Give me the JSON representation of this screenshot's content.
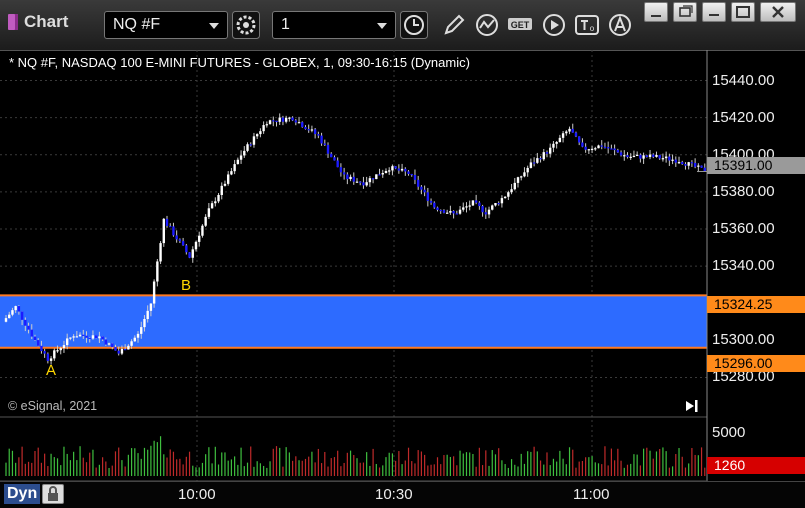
{
  "app": {
    "title": "Chart"
  },
  "toolbar": {
    "symbol": "NQ #F",
    "interval": "1"
  },
  "chart": {
    "symbol_title": "* NQ #F, NASDAQ 100 E-MINI FUTURES - GLOBEX, 1, 09:30-16:15 (Dynamic)",
    "copyright": "© eSignal, 2021",
    "current_price_label": "15391.00",
    "zone_high_label": "15324.25",
    "zone_low_label": "15296.00",
    "volume_label": "1260",
    "bottom_label": "Dyn",
    "marker_a": "A",
    "marker_b": "B",
    "y_ticks": [
      "15440.00",
      "15420.00",
      "15400.00",
      "15380.00",
      "15360.00",
      "15340.00",
      "15320.00",
      "15300.00",
      "15280.00"
    ],
    "volume_ticks": [
      "5000"
    ],
    "x_ticks": [
      "10:00",
      "10:30",
      "11:00"
    ]
  },
  "colors": {
    "bull": "#ffffff",
    "bear": "#1b1bff",
    "zone": "#2d6bff",
    "zone_line": "#ff7a20",
    "vol_up": "#3fbf3f",
    "vol_down": "#bf2a2a",
    "current": "#9a9a9a",
    "marker": "#ffd700"
  },
  "icons": [
    "settings-gear-icon",
    "clock-icon",
    "pencil-icon",
    "indicator-icon",
    "get-icon",
    "play-icon",
    "text-tool-icon",
    "alert-icon",
    "minimize-icon",
    "restore-icon",
    "maximize-icon",
    "close-icon",
    "lock-icon",
    "jump-end-icon"
  ],
  "chart_data": {
    "type": "candlestick",
    "x_axis": [
      "10:00",
      "10:30",
      "11:00"
    ],
    "y_range": [
      15270,
      15450
    ],
    "current_price": 15391.0,
    "zone": {
      "high": 15324.25,
      "low": 15296.0
    },
    "volume_ticks": [
      5000
    ],
    "volume_last": 1260,
    "anchor_points": [
      {
        "t": 0,
        "price": 15310
      },
      {
        "t": 4,
        "price": 15318
      },
      {
        "t": 10,
        "price": 15300
      },
      {
        "t": 14,
        "price": 15290
      },
      {
        "t": 22,
        "price": 15303
      },
      {
        "t": 30,
        "price": 15302
      },
      {
        "t": 36,
        "price": 15293
      },
      {
        "t": 42,
        "price": 15303
      },
      {
        "t": 46,
        "price": 15320
      },
      {
        "t": 50,
        "price": 15365
      },
      {
        "t": 54,
        "price": 15355
      },
      {
        "t": 58,
        "price": 15345
      },
      {
        "t": 64,
        "price": 15370
      },
      {
        "t": 74,
        "price": 15400
      },
      {
        "t": 82,
        "price": 15418
      },
      {
        "t": 90,
        "price": 15420
      },
      {
        "t": 98,
        "price": 15410
      },
      {
        "t": 106,
        "price": 15388
      },
      {
        "t": 112,
        "price": 15385
      },
      {
        "t": 120,
        "price": 15393
      },
      {
        "t": 126,
        "price": 15390
      },
      {
        "t": 134,
        "price": 15372
      },
      {
        "t": 140,
        "price": 15368
      },
      {
        "t": 146,
        "price": 15374
      },
      {
        "t": 150,
        "price": 15369
      },
      {
        "t": 156,
        "price": 15378
      },
      {
        "t": 164,
        "price": 15395
      },
      {
        "t": 170,
        "price": 15403
      },
      {
        "t": 176,
        "price": 15414
      },
      {
        "t": 180,
        "price": 15403
      },
      {
        "t": 186,
        "price": 15405
      },
      {
        "t": 194,
        "price": 15399
      },
      {
        "t": 202,
        "price": 15399
      },
      {
        "t": 210,
        "price": 15397
      },
      {
        "t": 217,
        "price": 15392
      }
    ]
  }
}
